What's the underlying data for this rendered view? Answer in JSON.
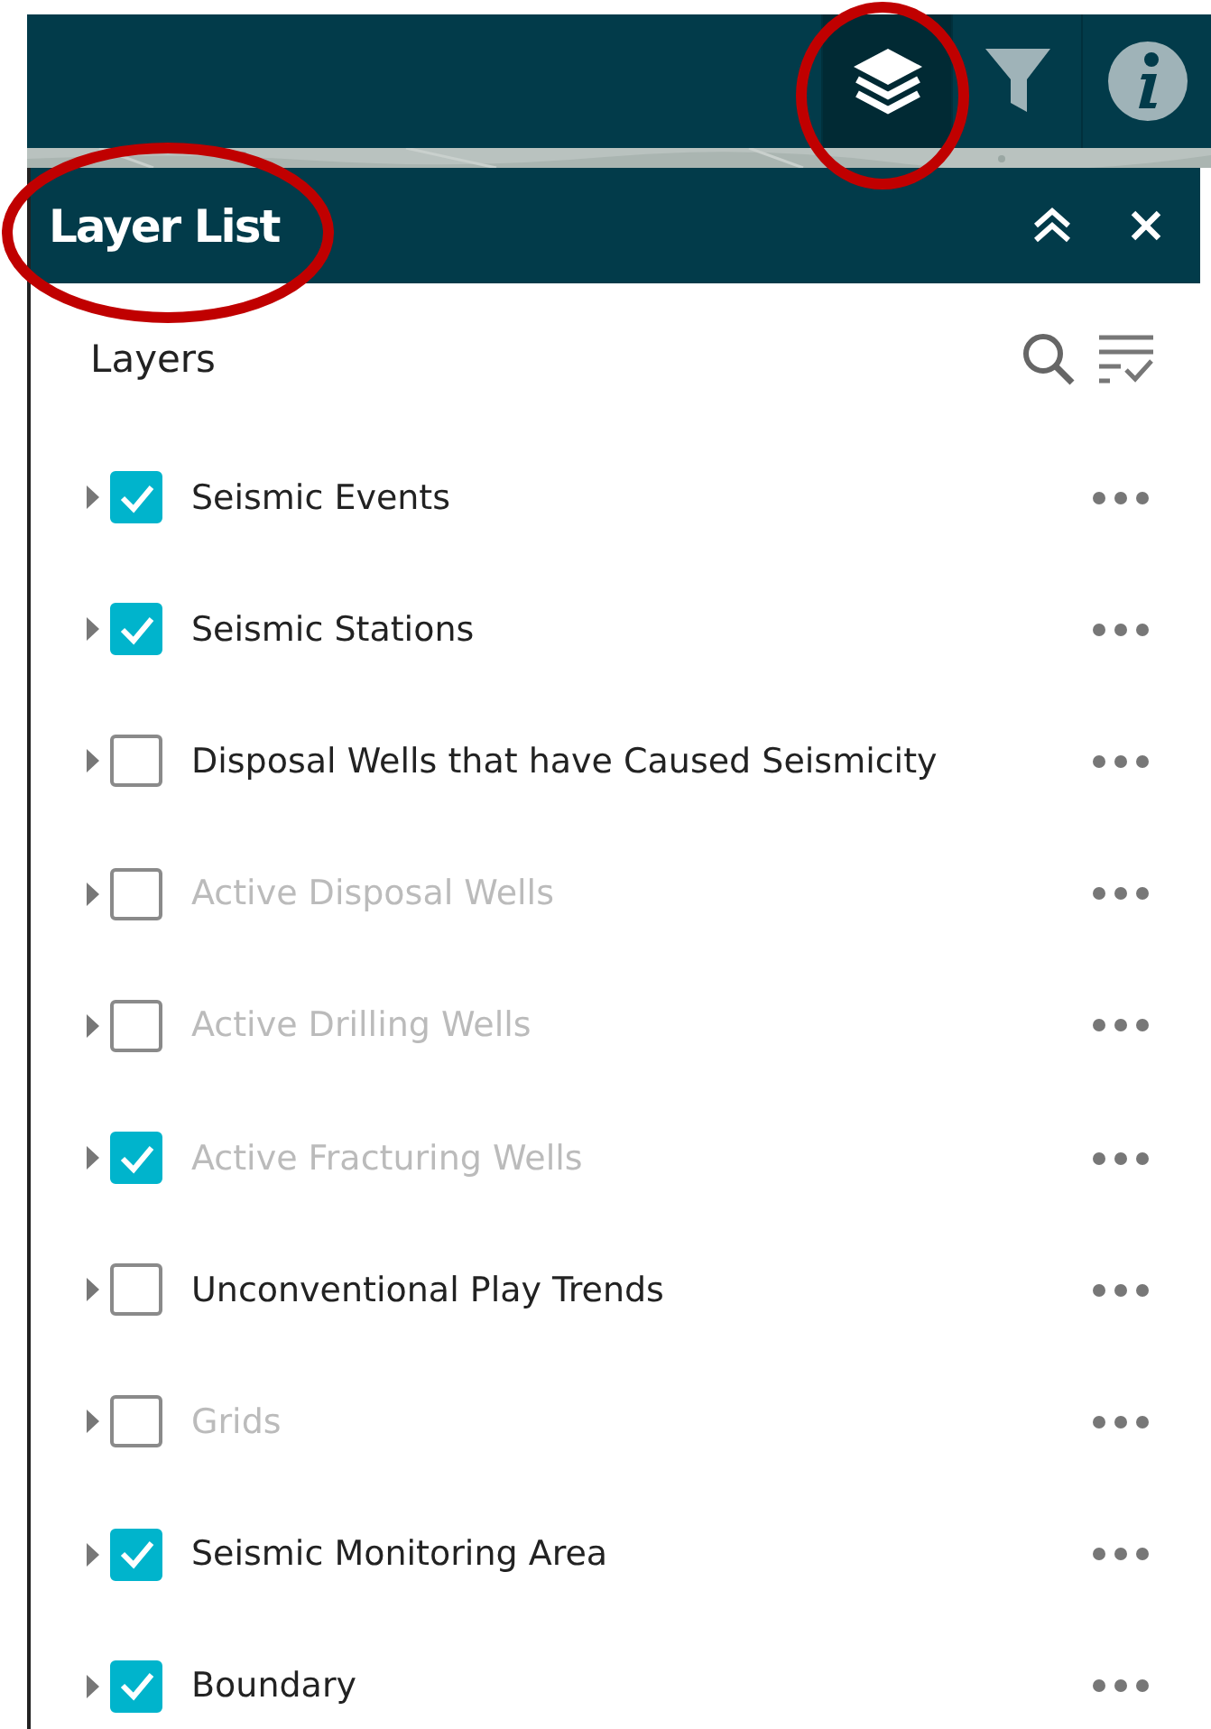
{
  "toolbar": {
    "tools": [
      {
        "selected": true
      },
      {
        "selected": false
      },
      {
        "selected": false
      }
    ]
  },
  "panel": {
    "title": "Layer List",
    "heading": "Layers"
  },
  "layers": [
    {
      "label": "Seismic Events",
      "checked": true,
      "dimmed": false
    },
    {
      "label": "Seismic Stations",
      "checked": true,
      "dimmed": false
    },
    {
      "label": "Disposal Wells that have Caused Seismicity",
      "checked": false,
      "dimmed": false
    },
    {
      "label": "Active Disposal Wells",
      "checked": false,
      "dimmed": true
    },
    {
      "label": "Active Drilling Wells",
      "checked": false,
      "dimmed": true
    },
    {
      "label": "Active Fracturing Wells",
      "checked": true,
      "dimmed": true
    },
    {
      "label": "Unconventional Play Trends",
      "checked": false,
      "dimmed": false
    },
    {
      "label": "Grids",
      "checked": false,
      "dimmed": true
    },
    {
      "label": "Seismic Monitoring Area",
      "checked": true,
      "dimmed": false
    },
    {
      "label": "Boundary",
      "checked": true,
      "dimmed": false
    }
  ]
}
